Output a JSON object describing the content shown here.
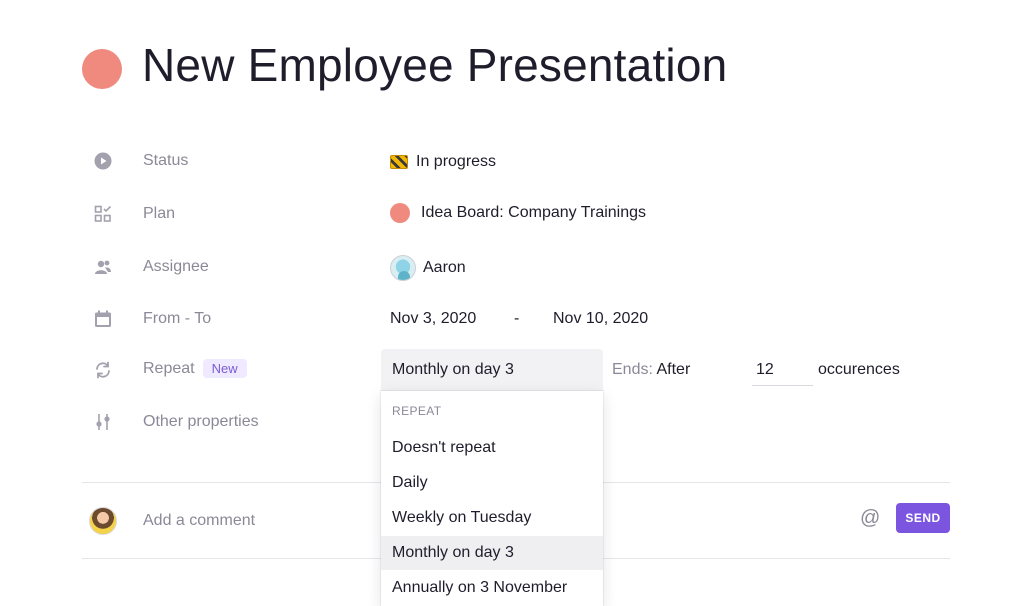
{
  "task": {
    "title": "New Employee Presentation",
    "title_color": "#f08a7e"
  },
  "properties": {
    "status": {
      "label": "Status",
      "value": "In progress",
      "icon": "play-circle-icon",
      "emoji": "construction-icon"
    },
    "plan": {
      "label": "Plan",
      "value": "Idea Board: Company Trainings",
      "icon": "plan-grid-icon",
      "plan_color": "#f08a7e"
    },
    "assignee": {
      "label": "Assignee",
      "value": "Aaron",
      "icon": "assignee-icon"
    },
    "dates": {
      "label": "From - To",
      "from": "Nov 3, 2020",
      "separator": "-",
      "to": "Nov 10, 2020",
      "icon": "calendar-icon"
    },
    "repeat": {
      "label": "Repeat",
      "badge": "New",
      "icon": "repeat-icon",
      "selected": "Monthly on day 3",
      "ends_label": "Ends:",
      "ends_value": "After",
      "occurrences": "12",
      "occurrences_label": "occurences"
    },
    "other": {
      "label": "Other properties",
      "icon": "sliders-icon"
    }
  },
  "repeat_menu": {
    "header": "REPEAT",
    "items": [
      {
        "label": "Doesn't repeat",
        "selected": false
      },
      {
        "label": "Daily",
        "selected": false
      },
      {
        "label": "Weekly on Tuesday",
        "selected": false
      },
      {
        "label": "Monthly on day 3",
        "selected": true
      },
      {
        "label": "Annually on 3 November",
        "selected": false
      }
    ]
  },
  "comment": {
    "placeholder": "Add a comment",
    "send_label": "SEND",
    "mention_icon": "at-icon",
    "accent": "#7b55e0"
  }
}
